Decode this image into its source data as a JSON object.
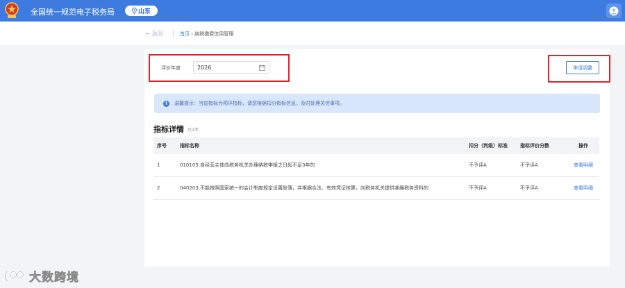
{
  "header": {
    "title": "全国统一规范电子税务局",
    "region": "山东",
    "brand_color": "#3d7be0"
  },
  "nav": {
    "back_label": "返回",
    "breadcrumb_home": "首页",
    "breadcrumb_separator": "›",
    "breadcrumb_current": "纳税缴费信用管理"
  },
  "form": {
    "year_label": "评价年度",
    "year_value": "2026",
    "apply_button": "申请调整"
  },
  "tip": {
    "icon": "info-icon",
    "text": "温馨提示：当前指标为预评指标，请您根据扣分指标信息，及时处理关信事项。"
  },
  "section": {
    "title": "指标详情",
    "count": "共2项"
  },
  "table": {
    "headers": [
      "序号",
      "指标名称",
      "扣分（判级）标准",
      "指标评价分数",
      "操作"
    ],
    "rows": [
      [
        "1",
        "010105.自经营主体向税务机关办理纳税申报之日起不足3年的",
        "不予评A",
        "不予评A",
        "查看明细"
      ],
      [
        "2",
        "040203.不能按照国家统一的会计制度规定设置账簿，并根据合法、有效凭证核算，向税务机关提供准确税务资料的",
        "不予评A",
        "不予评A",
        "查看明细"
      ]
    ]
  },
  "watermark": {
    "text": "大数跨境"
  }
}
